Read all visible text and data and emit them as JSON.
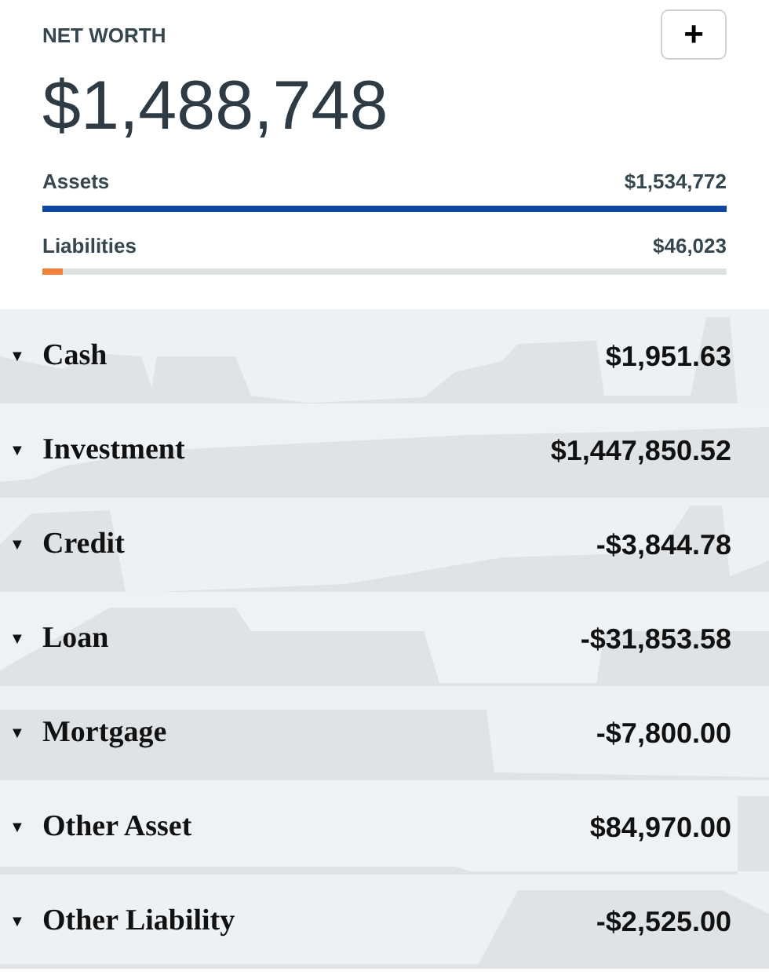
{
  "net_worth": {
    "label": "NET WORTH",
    "add_button": "+",
    "total": "$1,488,748"
  },
  "bars": [
    {
      "label": "Assets",
      "amount": "$1,534,772",
      "level": 1,
      "color": "#0d47a1"
    },
    {
      "label": "Liabilities",
      "amount": "$46,023",
      "level": 0.03,
      "color": "#f0813a"
    }
  ],
  "accounts": [
    {
      "caret": "▼",
      "name": "Cash",
      "amount": "$1,951.63"
    },
    {
      "caret": "▼",
      "name": "Investment",
      "amount": "$1,447,850.52"
    },
    {
      "caret": "▼",
      "name": "Credit",
      "amount": "-$3,844.78"
    },
    {
      "caret": "▼",
      "name": "Loan",
      "amount": "-$31,853.58"
    },
    {
      "caret": "▼",
      "name": "Mortgage",
      "amount": "-$7,800.00"
    },
    {
      "caret": "▼",
      "name": "Other Asset",
      "amount": "$84,970.00"
    },
    {
      "caret": "▼",
      "name": "Other Liability",
      "amount": "-$2,525.00"
    }
  ]
}
